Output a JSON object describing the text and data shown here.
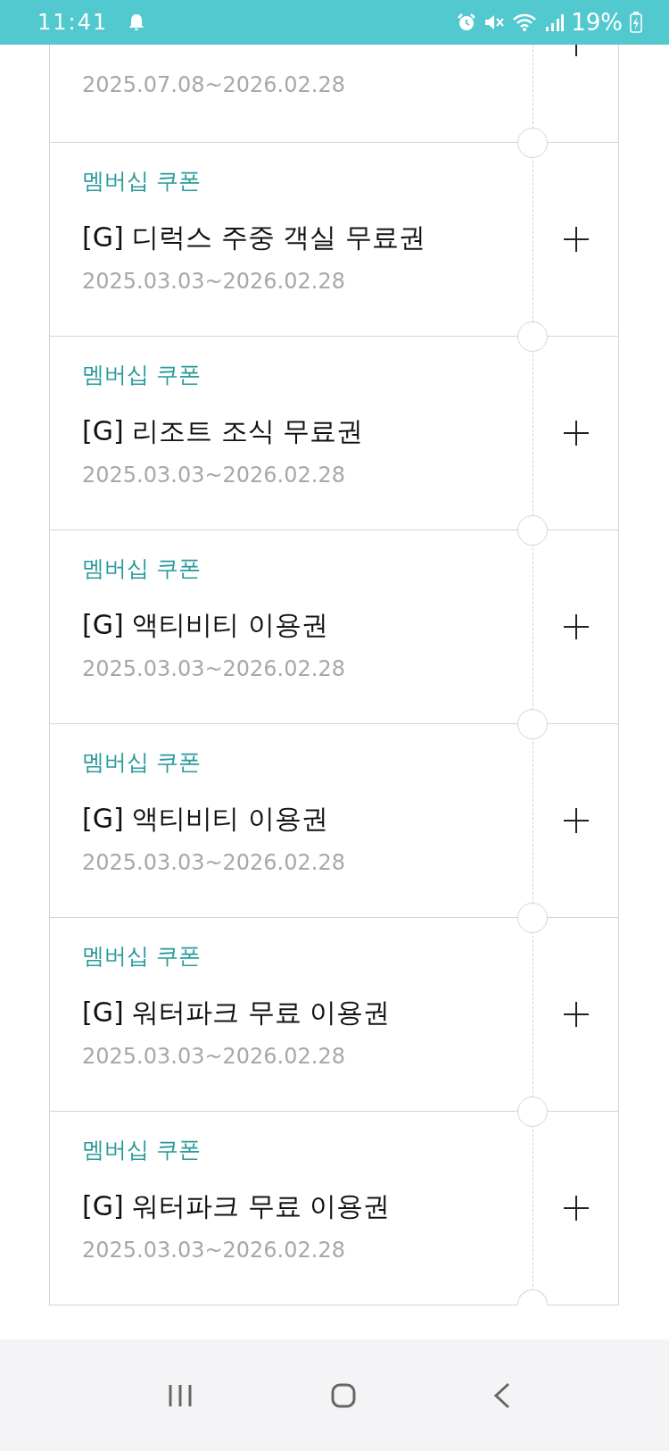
{
  "status_bar": {
    "time": "11:41",
    "battery": "19%"
  },
  "coupons": [
    {
      "kind": "partial",
      "date": "2025.07.08~2026.02.28"
    },
    {
      "kind": "full",
      "category": "멤버십 쿠폰",
      "title": "[G] 디럭스 주중 객실 무료권",
      "date": "2025.03.03~2026.02.28"
    },
    {
      "kind": "full",
      "category": "멤버십 쿠폰",
      "title": "[G] 리조트 조식 무료권",
      "date": "2025.03.03~2026.02.28"
    },
    {
      "kind": "full",
      "category": "멤버십 쿠폰",
      "title": "[G] 액티비티 이용권",
      "date": "2025.03.03~2026.02.28"
    },
    {
      "kind": "full",
      "category": "멤버십 쿠폰",
      "title": "[G] 액티비티 이용권",
      "date": "2025.03.03~2026.02.28"
    },
    {
      "kind": "full",
      "category": "멤버십 쿠폰",
      "title": "[G] 워터파크 무료 이용권",
      "date": "2025.03.03~2026.02.28"
    },
    {
      "kind": "full",
      "category": "멤버십 쿠폰",
      "title": "[G] 워터파크 무료 이용권",
      "date": "2025.03.03~2026.02.28"
    }
  ]
}
